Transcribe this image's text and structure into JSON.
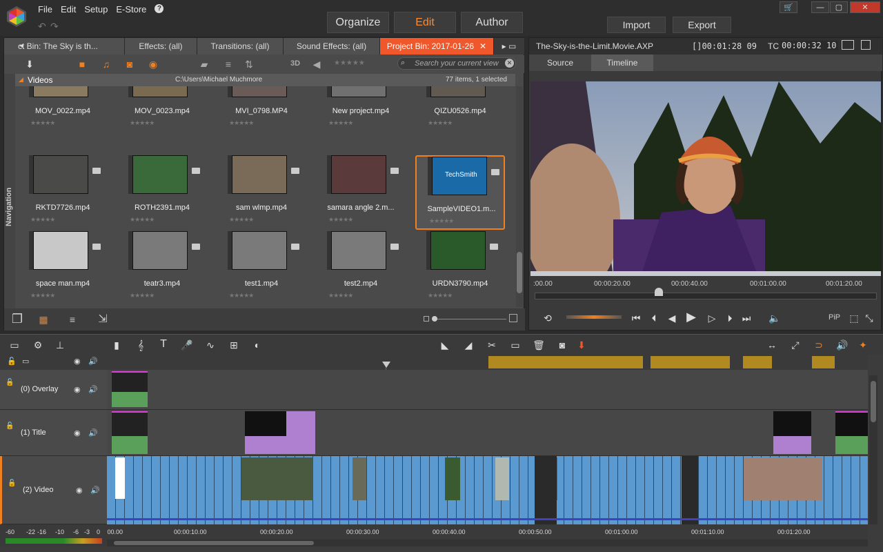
{
  "menu": [
    "File",
    "Edit",
    "Setup",
    "E-Store"
  ],
  "mode_tabs": {
    "organize": "Organize",
    "edit": "Edit",
    "author": "Author"
  },
  "actions": {
    "import": "Import",
    "export": "Export"
  },
  "library": {
    "tabs": [
      "ct Bin: The Sky is th...",
      "Effects: (all)",
      "Transitions: (all)",
      "Sound Effects: (all)",
      "Project Bin: 2017-01-26"
    ],
    "view_3d": "3D",
    "search_placeholder": "Search your current view",
    "section": "Videos",
    "path": "C:\\Users\\Michael Muchmore",
    "count": "77 items, 1 selected",
    "nav_label": "Navigation",
    "clips": [
      {
        "name": "MOV_0022.mp4",
        "color": "#8a7a60"
      },
      {
        "name": "MOV_0023.mp4",
        "color": "#7a6a50"
      },
      {
        "name": "MVI_0798.MP4",
        "color": "#6a5a58"
      },
      {
        "name": "New project.mp4",
        "color": "#707070"
      },
      {
        "name": "QIZU0526.mp4",
        "color": "#605a50"
      },
      {
        "name": "RKTD7726.mp4",
        "color": "#4a4a48"
      },
      {
        "name": "ROTH2391.mp4",
        "color": "#3a6a3a"
      },
      {
        "name": "sam wlmp.mp4",
        "color": "#7a6a58"
      },
      {
        "name": "samara angle 2.m...",
        "color": "#5a3a3a"
      },
      {
        "name": "SampleVIDEO1.m...",
        "color": "#1a6aa8"
      },
      {
        "name": "space man.mp4",
        "color": "#c8c8c8"
      },
      {
        "name": "teatr3.mp4",
        "color": "#7a7a7a"
      },
      {
        "name": "test1.mp4",
        "color": "#7a7a7a"
      },
      {
        "name": "test2.mp4",
        "color": "#7a7a7a"
      },
      {
        "name": "URDN3790.mp4",
        "color": "#2a5a2a"
      }
    ],
    "selected_clip_text": "TechSmith"
  },
  "preview": {
    "title": "The-Sky-is-the-Limit.Movie.AXP",
    "duration": "[]00:01:28 09",
    "tc_label": "TC",
    "timecode": "00:00:32 10",
    "tabs": {
      "source": "Source",
      "timeline": "Timeline"
    },
    "ruler": [
      ":00.00",
      "00:00:20.00",
      "00:00:40.00",
      "00:01:00.00",
      "00:01:20.00"
    ],
    "pip": "PiP"
  },
  "timeline": {
    "tracks": [
      {
        "name": "(0) Overlay"
      },
      {
        "name": "(1) Title"
      },
      {
        "name": "(2) Video"
      }
    ],
    "ruler": [
      ":00.00",
      "00:00:10.00",
      "00:00:20.00",
      "00:00:30.00",
      "00:00:40.00",
      "00:00:50.00",
      "00:01:00.00",
      "00:01:10.00",
      "00:01:20.00"
    ],
    "meter": [
      "-60",
      "-22",
      "-16",
      "-10",
      "-6",
      "-3",
      "0"
    ]
  },
  "colors": {
    "accent": "#f0572a",
    "orange": "#ff8a2a",
    "clip_blue": "#5a9ad0",
    "title_purple": "#b080d0"
  }
}
